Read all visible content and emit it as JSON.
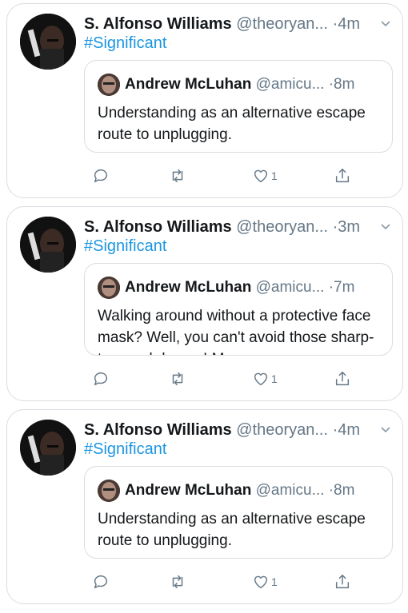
{
  "tweets": [
    {
      "author_name": "S. Alfonso Williams",
      "handle": "@theoryan...",
      "separator": "·",
      "time": "4m",
      "hashtag": "#Significant",
      "quote": {
        "author_name": "Andrew McLuhan",
        "handle": "@amicu...",
        "separator": "·",
        "time": "8m",
        "text": "Understanding as an alternative escape route to unplugging."
      },
      "likes": "1"
    },
    {
      "author_name": "S. Alfonso Williams",
      "handle": "@theoryan...",
      "separator": "·",
      "time": "3m",
      "hashtag": "#Significant",
      "quote": {
        "author_name": "Andrew McLuhan",
        "handle": "@amicu...",
        "separator": "·",
        "time": "7m",
        "text": "Walking around without a protective face mask? Well, you can't avoid those sharp-tongued drones! Many"
      },
      "likes": "1"
    },
    {
      "author_name": "S. Alfonso Williams",
      "handle": "@theoryan...",
      "separator": "·",
      "time": "4m",
      "hashtag": "#Significant",
      "quote": {
        "author_name": "Andrew McLuhan",
        "handle": "@amicu...",
        "separator": "·",
        "time": "8m",
        "text": "Understanding as an alternative escape route to unplugging."
      },
      "likes": "1"
    }
  ],
  "icons": {
    "reply": "reply-icon",
    "retweet": "retweet-icon",
    "like": "heart-icon",
    "share": "share-icon",
    "menu": "chevron-down-icon"
  },
  "colors": {
    "link": "#1b95e0",
    "secondary_text": "#657786",
    "border": "#d9dde1"
  }
}
